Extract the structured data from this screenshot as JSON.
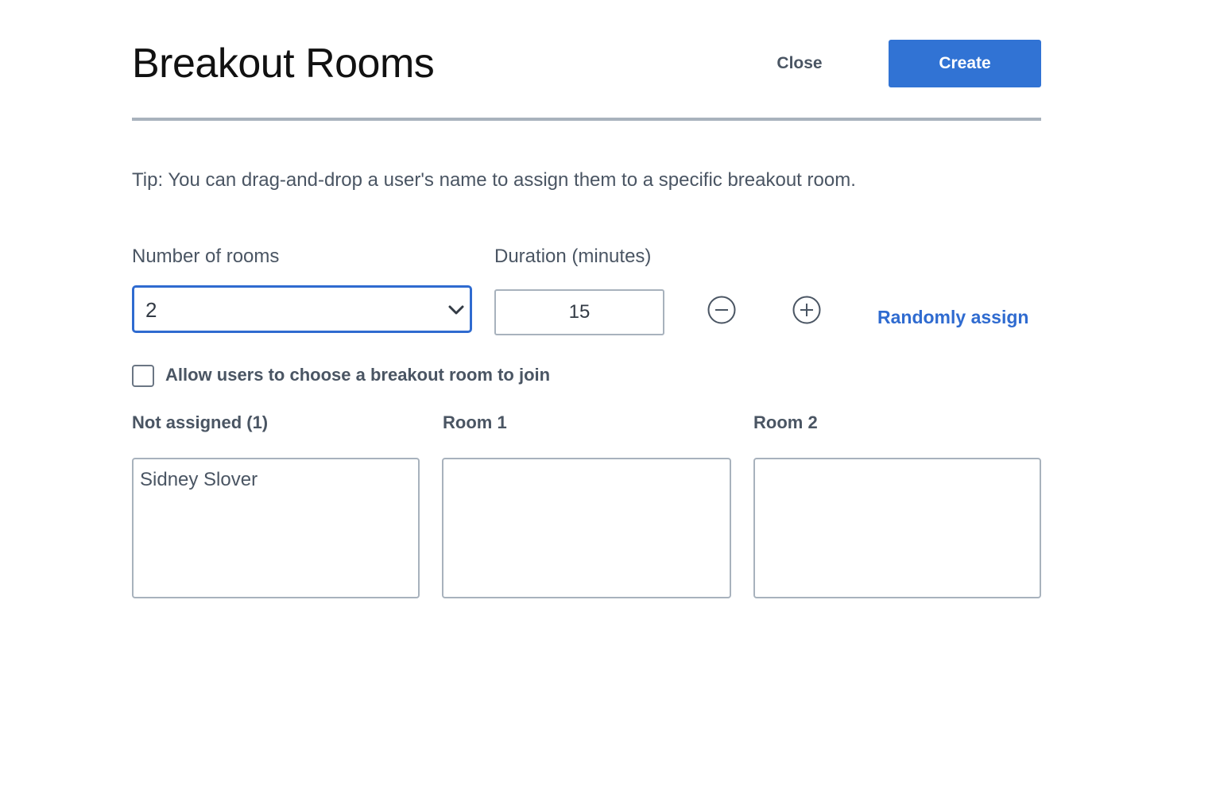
{
  "header": {
    "title": "Breakout Rooms",
    "close_label": "Close",
    "create_label": "Create"
  },
  "tip": "Tip: You can drag-and-drop a user's name to assign them to a specific breakout room.",
  "rooms": {
    "label": "Number of rooms",
    "selected": "2"
  },
  "duration": {
    "label": "Duration (minutes)",
    "value": "15"
  },
  "randomly_assign_label": "Randomly assign",
  "allow_choose": {
    "label": "Allow users to choose a breakout room to join",
    "checked": false
  },
  "columns": [
    {
      "label": "Not assigned (1)",
      "users": [
        "Sidney Slover"
      ]
    },
    {
      "label": "Room 1",
      "users": []
    },
    {
      "label": "Room 2",
      "users": []
    }
  ],
  "colors": {
    "accent": "#3173d4",
    "text": "#4a5563",
    "border": "#a8b2bd"
  },
  "icons": {
    "dropdown": "chevron-down-icon",
    "decrement": "minus-circle-icon",
    "increment": "plus-circle-icon"
  }
}
